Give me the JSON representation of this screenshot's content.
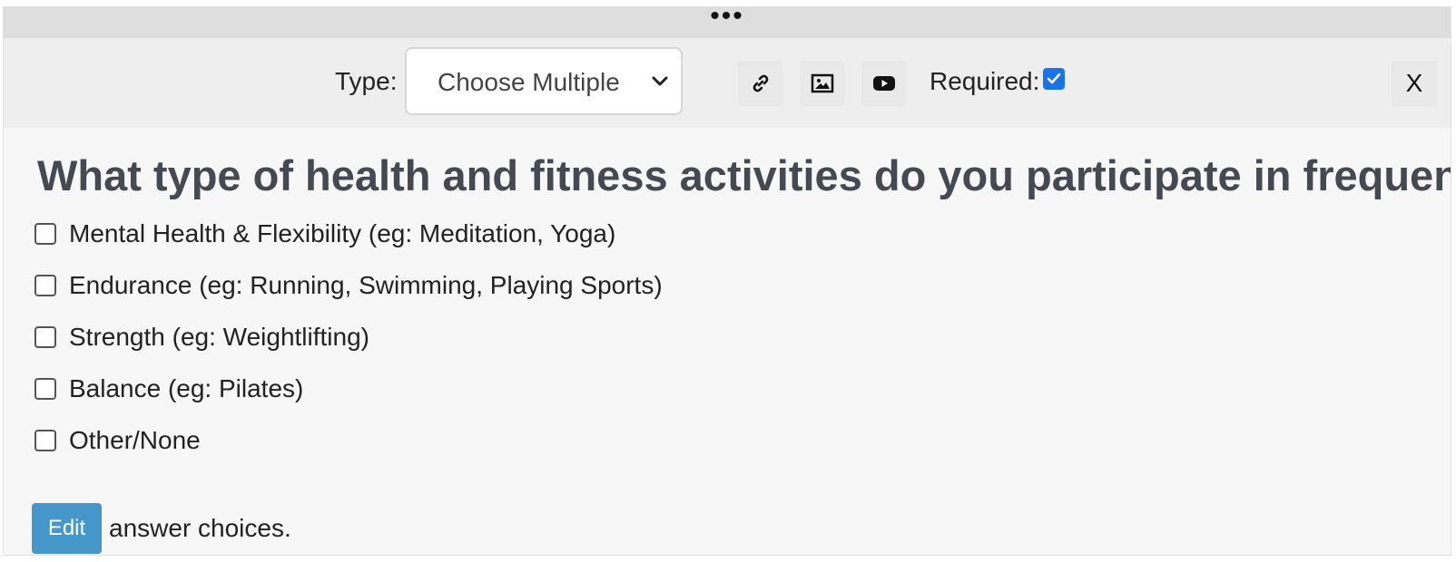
{
  "drag_handle": {
    "glyph": "•••"
  },
  "toolbar": {
    "type_label": "Type:",
    "type_select": {
      "selected": "Choose Multiple"
    },
    "icons": [
      "link-icon",
      "image-icon",
      "video-icon"
    ],
    "required_label": "Required:",
    "required_checked": true,
    "close_label": "X"
  },
  "question": {
    "title": "What type of health and fitness activities do you participate in frequent",
    "options": [
      "Mental Health & Flexibility (eg: Meditation, Yoga)",
      "Endurance (eg: Running, Swimming, Playing Sports)",
      "Strength (eg: Weightlifting)",
      "Balance (eg: Pilates)",
      "Other/None"
    ]
  },
  "footer": {
    "edit_label": "Edit",
    "edit_suffix": "answer choices."
  },
  "colors": {
    "accent": "#4497c8",
    "checkbox_checked": "#1a73e8",
    "title": "#454a52"
  }
}
